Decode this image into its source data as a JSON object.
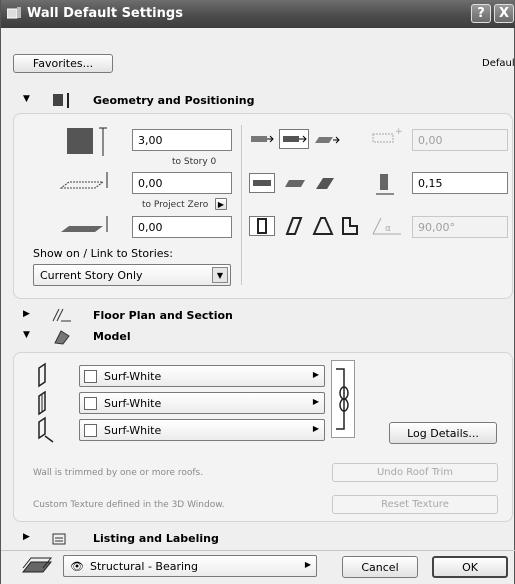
{
  "window": {
    "title": "Wall Default Settings",
    "help_label": "?",
    "close_label": "X"
  },
  "top": {
    "favorites_label": "Favorites...",
    "default_label": "Default"
  },
  "sections": {
    "geometry": {
      "label": "Geometry and Positioning"
    },
    "floor_plan": {
      "label": "Floor Plan and Section"
    },
    "model": {
      "label": "Model"
    },
    "listing": {
      "label": "Listing and Labeling"
    }
  },
  "geometry": {
    "height_value": "3,00",
    "height_ref": "to Story 0",
    "base_value": "0,00",
    "base_ref": "to Project Zero",
    "third_value": "0,00",
    "offset_value": "0,00",
    "thickness_value": "0,15",
    "angle_value": "90,00°",
    "show_on_label": "Show on / Link to Stories:",
    "story_select": "Current Story Only"
  },
  "model": {
    "materials": [
      "Surf-White",
      "Surf-White",
      "Surf-White"
    ],
    "log_details_label": "Log Details...",
    "roof_msg": "Wall is trimmed by one or more roofs.",
    "undo_roof_label": "Undo Roof Trim",
    "texture_msg": "Custom Texture defined in the 3D Window.",
    "reset_texture_label": "Reset Texture"
  },
  "bottom": {
    "layer": "Structural - Bearing",
    "cancel_label": "Cancel",
    "ok_label": "OK"
  },
  "colors": {
    "titlebar": "#4a4a4a",
    "background": "#efefef"
  }
}
